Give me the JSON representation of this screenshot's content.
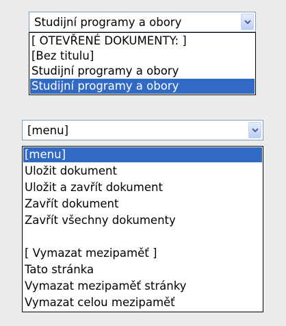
{
  "colors": {
    "page_background": "#ebebeb",
    "selection_background": "#316ac5",
    "selection_text": "#ffffff",
    "field_border": "#7f9db9"
  },
  "documents_select": {
    "selected_value": "Studijní programy a obory",
    "arrow_icon": "chevron-down-icon",
    "options": [
      "[ OTEVŘENÉ DOKUMENTY: ]",
      "[Bez titulu]",
      "Studijní programy a obory",
      "Studijní programy a obory"
    ],
    "highlighted_index": 3
  },
  "menu_select": {
    "selected_value": "[menu]",
    "arrow_icon": "chevron-down-icon",
    "options": [
      "[menu]",
      "Uložit dokument",
      "Uložit a zavřít dokument",
      "Zavřít dokument",
      "Zavřít všechny dokumenty",
      "",
      "[ Vymazat mezipaměť ]",
      "Tato stránka",
      "Vymazat mezipaměť stránky",
      "Vymazat celou mezipaměť"
    ],
    "highlighted_index": 0
  }
}
